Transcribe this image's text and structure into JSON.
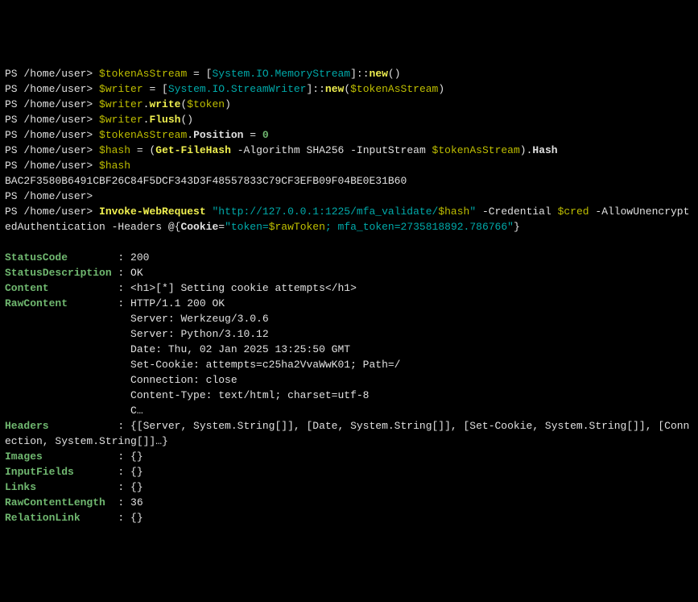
{
  "lines": {
    "l1_prompt": "PS /home/user> ",
    "l1_var": "$tokenAsStream",
    "l1_eq": " = [",
    "l1_type": "System.IO.MemoryStream",
    "l1_close": "]::",
    "l1_new": "new",
    "l1_paren": "()",
    "l2_prompt": "PS /home/user> ",
    "l2_var": "$writer",
    "l2_eq": " = [",
    "l2_type": "System.IO.StreamWriter",
    "l2_close": "]::",
    "l2_new": "new",
    "l2_paren_open": "(",
    "l2_arg": "$tokenAsStream",
    "l2_paren_close": ")",
    "l3_prompt": "PS /home/user> ",
    "l3_var": "$writer",
    "l3_dot": ".",
    "l3_method": "write",
    "l3_paren_open": "(",
    "l3_arg": "$token",
    "l3_paren_close": ")",
    "l4_prompt": "PS /home/user> ",
    "l4_var": "$writer",
    "l4_dot": ".",
    "l4_method": "Flush",
    "l4_paren": "()",
    "l5_prompt": "PS /home/user> ",
    "l5_var": "$tokenAsStream",
    "l5_dot": ".",
    "l5_prop": "Position",
    "l5_eq": " = ",
    "l5_val": "0",
    "l6_prompt": "PS /home/user> ",
    "l6_var": "$hash",
    "l6_eq": " = (",
    "l6_cmd": "Get-FileHash",
    "l6_p1": " -Algorithm",
    "l6_alg": " SHA256",
    "l6_p2": " -InputStream",
    "l6_arg": " $tokenAsStream",
    "l6_close": ").",
    "l6_hash": "Hash",
    "l7_prompt": "PS /home/user> ",
    "l7_var": "$hash",
    "l8_hash": "BAC2F3580B6491CBF26C84F5DCF343D3F48557833C79CF3EFB09F04BE0E31B60",
    "l9_prompt": "PS /home/user>",
    "l10_prompt": "PS /home/user> ",
    "l10_cmd": "Invoke-WebRequest",
    "l10_sp": " ",
    "l10_url1": "\"http://127.0.0.1:1225/mfa_validate/",
    "l10_urlvar": "$hash",
    "l10_url2": "\"",
    "l10_p1": " -Credential",
    "l10_cred": " $cred",
    "l10_p2": " -AllowUnencryptedAuthentication",
    "l10_p3": " -Headers",
    "l10_at": " @{",
    "l10_cookie": "Cookie",
    "l10_eq": "=",
    "l10_q1": "\"token=",
    "l10_raw": "$rawToken",
    "l10_sc": ";",
    "l10_mfa": " mfa_token=2735818892.786766\"",
    "l10_close": "}",
    "out_status_code_label": "StatusCode",
    "out_status_code_colon": "        : ",
    "out_status_code_val": "200",
    "out_status_desc_label": "StatusDescription",
    "out_status_desc_colon": " : ",
    "out_status_desc_val": "OK",
    "out_content_label": "Content",
    "out_content_colon": "           : ",
    "out_content_val": "<h1>[*] Setting cookie attempts</h1>",
    "out_rawcontent_label": "RawContent",
    "out_rawcontent_colon": "        : ",
    "out_rawcontent_l1": "HTTP/1.1 200 OK",
    "out_rawcontent_pad": "                    ",
    "out_rawcontent_l2": "Server: Werkzeug/3.0.6",
    "out_rawcontent_l3": "Server: Python/3.10.12",
    "out_rawcontent_l4": "Date: Thu, 02 Jan 2025 13:25:50 GMT",
    "out_rawcontent_l5": "Set-Cookie: attempts=c25ha2VvaWwK01; Path=/",
    "out_rawcontent_l6": "Connection: close",
    "out_rawcontent_l7": "Content-Type: text/html; charset=utf-8",
    "out_rawcontent_l8": "C…",
    "out_headers_label": "Headers",
    "out_headers_colon": "           : ",
    "out_headers_l1": "{[Server, System.String[]], [Date, System.String[]], [Set-Cookie, System.String[]], [Connection, System.String[]]…}",
    "out_images_label": "Images",
    "out_images_colon": "            : ",
    "out_images_val": "{}",
    "out_inputfields_label": "InputFields",
    "out_inputfields_colon": "       : ",
    "out_inputfields_val": "{}",
    "out_links_label": "Links",
    "out_links_colon": "             : ",
    "out_links_val": "{}",
    "out_rawlen_label": "RawContentLength",
    "out_rawlen_colon": "  : ",
    "out_rawlen_val": "36",
    "out_rellink_label": "RelationLink",
    "out_rellink_colon": "      : ",
    "out_rellink_val": "{}"
  }
}
